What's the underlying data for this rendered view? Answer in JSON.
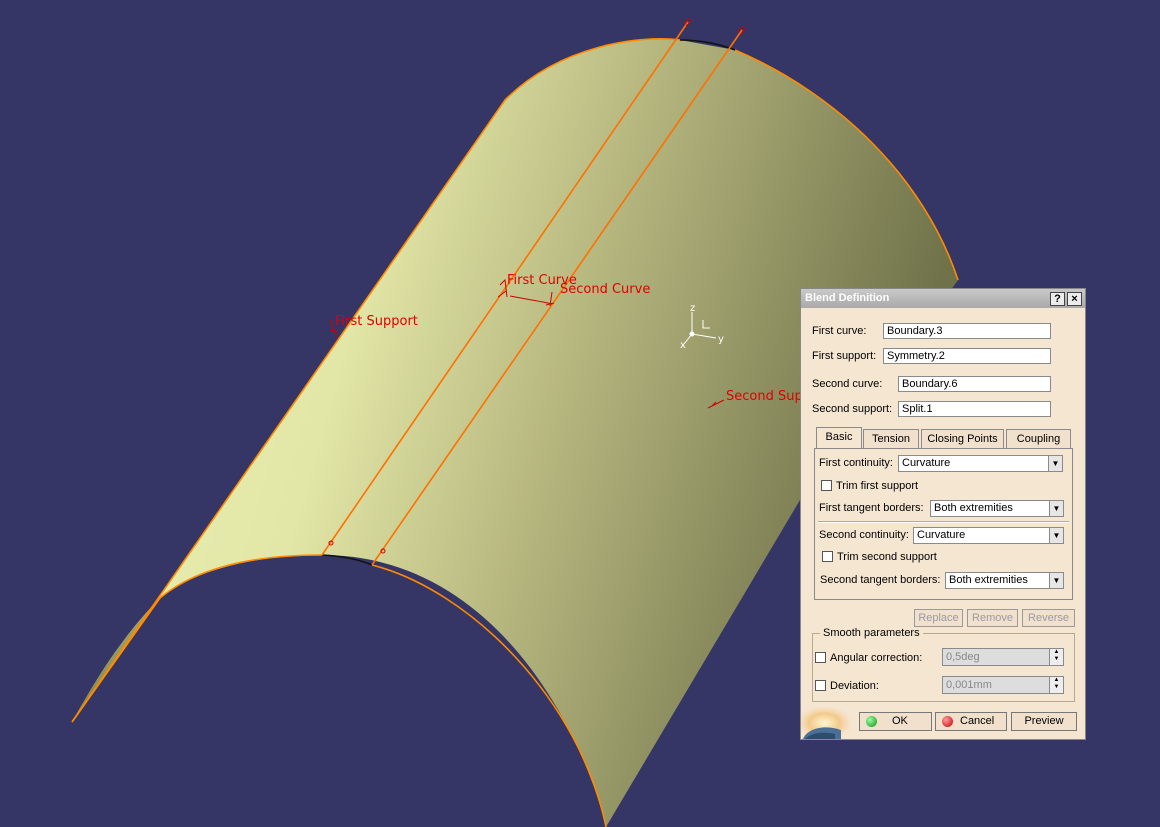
{
  "viewport": {
    "labels": {
      "first_curve": "First Curve",
      "second_curve": "Second Curve",
      "first_support": "First Support",
      "second_support": "Second Supp"
    },
    "axes": {
      "z": "z",
      "y": "y",
      "x": "x"
    },
    "colors": {
      "background": "#353566",
      "label": "#e00000",
      "edge": "#ff8a00"
    }
  },
  "dialog": {
    "title": "Blend Definition",
    "help_btn": "?",
    "close_btn": "×",
    "fields": {
      "first_curve": {
        "label": "First curve:",
        "value": "Boundary.3"
      },
      "first_support": {
        "label": "First support:",
        "value": "Symmetry.2"
      },
      "second_curve": {
        "label": "Second curve:",
        "value": "Boundary.6"
      },
      "second_support": {
        "label": "Second support:",
        "value": "Split.1"
      }
    },
    "tabs": [
      "Basic",
      "Tension",
      "Closing Points",
      "Coupling"
    ],
    "basic": {
      "first_continuity_label": "First continuity:",
      "first_continuity_value": "Curvature",
      "trim_first_label": "Trim first support",
      "first_tangent_label": "First tangent borders:",
      "first_tangent_value": "Both extremities",
      "second_continuity_label": "Second continuity:",
      "second_continuity_value": "Curvature",
      "trim_second_label": "Trim second support",
      "second_tangent_label": "Second tangent borders:",
      "second_tangent_value": "Both extremities"
    },
    "actions": {
      "replace": "Replace",
      "remove": "Remove",
      "reverse": "Reverse"
    },
    "smooth": {
      "title": "Smooth parameters",
      "angular_label": "Angular correction:",
      "angular_value": "0,5deg",
      "deviation_label": "Deviation:",
      "deviation_value": "0,001mm"
    },
    "buttons": {
      "ok": "OK",
      "cancel": "Cancel",
      "preview": "Preview"
    }
  }
}
